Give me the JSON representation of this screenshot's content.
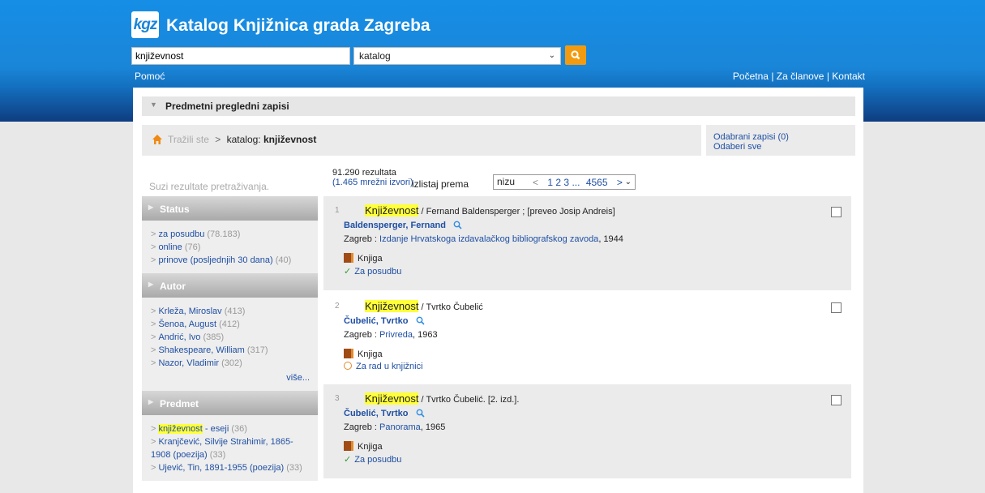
{
  "header": {
    "logo_text": "kgz",
    "title": "Katalog Knjižnica grada Zagreba",
    "search_value": "književnost",
    "scope_value": "katalog",
    "help": "Pomoć",
    "top_links": [
      "Početna",
      "Za članove",
      "Kontakt"
    ],
    "separator": "|"
  },
  "facet_bar": {
    "label": "Predmetni pregledni zapisi"
  },
  "breadcrumb": {
    "prefix": "Tražili ste",
    "arrow": ">",
    "label": "katalog:",
    "query": "književnost"
  },
  "selection": {
    "selected": "Odabrani zapisi (0)",
    "select_all": "Odaberi sve"
  },
  "refine_label": "Suzi rezultate pretraživanja.",
  "results_info": {
    "count": "91.290 rezultata",
    "online": "(1.465 mrežni izvori)"
  },
  "sort": {
    "label": "izlistaj prema",
    "value": "nizu"
  },
  "pager": {
    "prev": "<",
    "pages": [
      "1",
      "2",
      "3"
    ],
    "ellipsis": "...",
    "last": "4565",
    "next": ">"
  },
  "facets": [
    {
      "title": "Status",
      "items": [
        {
          "label": "za posudbu",
          "count": "(78.183)"
        },
        {
          "label": "online",
          "count": "(76)"
        },
        {
          "label": "prinove (posljednjih 30 dana)",
          "count": "(40)"
        }
      ]
    },
    {
      "title": "Autor",
      "items": [
        {
          "label": "Krleža, Miroslav",
          "count": "(413)"
        },
        {
          "label": "Šenoa, August",
          "count": "(412)"
        },
        {
          "label": "Andrić, Ivo",
          "count": "(385)"
        },
        {
          "label": "Shakespeare, William",
          "count": "(317)"
        },
        {
          "label": "Nazor, Vladimir",
          "count": "(302)"
        }
      ],
      "more": "više..."
    },
    {
      "title": "Predmet",
      "items": [
        {
          "label_hl": "književnost",
          "label_rest": " - eseji",
          "count": "(36)"
        },
        {
          "label": "Kranjčević, Silvije Strahimir, 1865-1908 (poezija)",
          "count": "(33)"
        },
        {
          "label": "Ujević, Tin, 1891-1955 (poezija)",
          "count": "(33)"
        }
      ]
    }
  ],
  "results": [
    {
      "num": "1",
      "title_kw": "Književnost",
      "title_rest": " / Fernand Baldensperger ; [preveo Josip Andreis]",
      "author": "Baldensperger, Fernand",
      "pub_place": "Zagreb : ",
      "publisher": "Izdanje Hrvatskoga izdavalačkog bibliografskog zavoda",
      "year": ", 1944",
      "type": "Knjiga",
      "status": "Za posudbu",
      "status_kind": "available",
      "shaded": true
    },
    {
      "num": "2",
      "title_kw": "Književnost",
      "title_rest": " / Tvrtko Čubelić",
      "author": "Čubelić, Tvrtko",
      "pub_place": "Zagreb : ",
      "publisher": "Privreda",
      "year": ", 1963",
      "type": "Knjiga",
      "status": "Za rad u knjižnici",
      "status_kind": "in-library",
      "shaded": false
    },
    {
      "num": "3",
      "title_kw": "Književnost",
      "title_rest": " / Tvrtko Čubelić. [2. izd.].",
      "author": "Čubelić, Tvrtko",
      "pub_place": "Zagreb : ",
      "publisher": "Panorama",
      "year": ", 1965",
      "type": "Knjiga",
      "status": "Za posudbu",
      "status_kind": "available",
      "shaded": true
    }
  ],
  "colors": {
    "header_blue": "#1a86d8",
    "search_orange": "#f39b10",
    "link_blue": "#1f4fa3",
    "highlight": "#ffff3a"
  }
}
